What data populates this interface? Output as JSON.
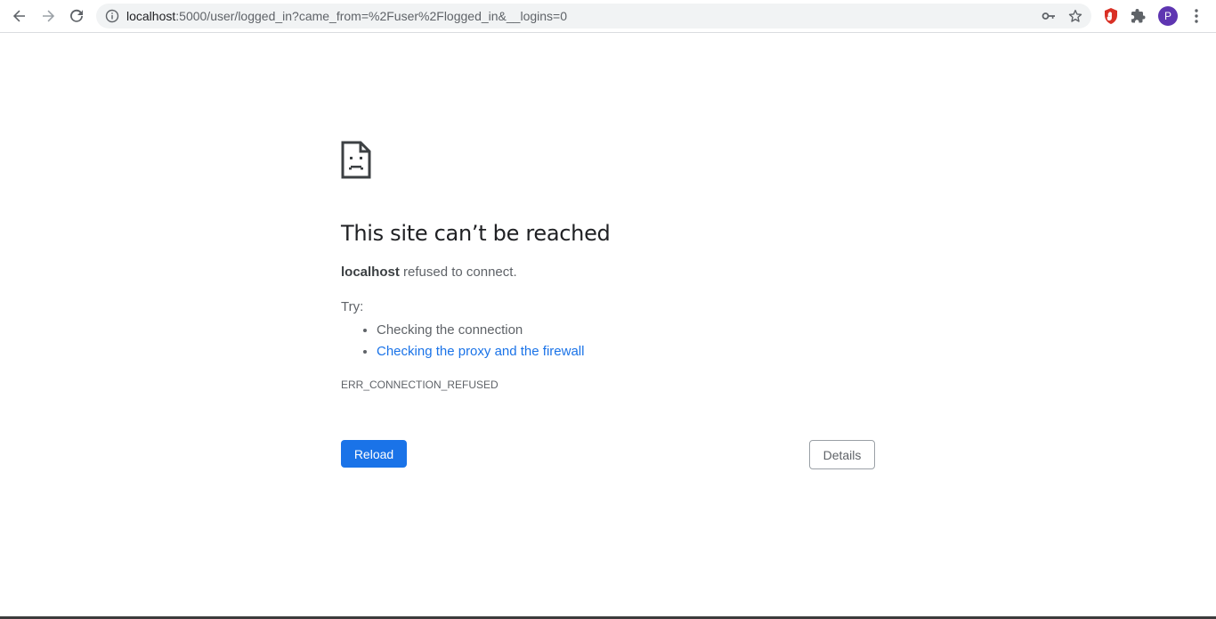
{
  "browser": {
    "url_host": "localhost",
    "url_rest": ":5000/user/logged_in?came_from=%2Fuser%2Flogged_in&__logins=0",
    "avatar_letter": "P",
    "icons": {
      "back": "arrow-left-icon",
      "forward": "arrow-right-icon",
      "reload": "reload-icon",
      "info": "info-icon",
      "key": "key-icon",
      "star": "star-icon",
      "extension_shield": "hand-shield-icon",
      "extensions": "puzzle-icon",
      "menu": "kebab-menu-icon"
    }
  },
  "error_page": {
    "icon": "sad-page-icon",
    "title": "This site can’t be reached",
    "host": "localhost",
    "summary_rest": " refused to connect.",
    "try_label": "Try:",
    "suggestions": [
      "Checking the connection",
      "Checking the proxy and the firewall"
    ],
    "error_code": "ERR_CONNECTION_REFUSED",
    "reload_label": "Reload",
    "details_label": "Details"
  },
  "colors": {
    "primary": "#1a73e8",
    "text_secondary": "#5f6368",
    "avatar": "#5e35b1",
    "shield_ext": "#d93025"
  }
}
